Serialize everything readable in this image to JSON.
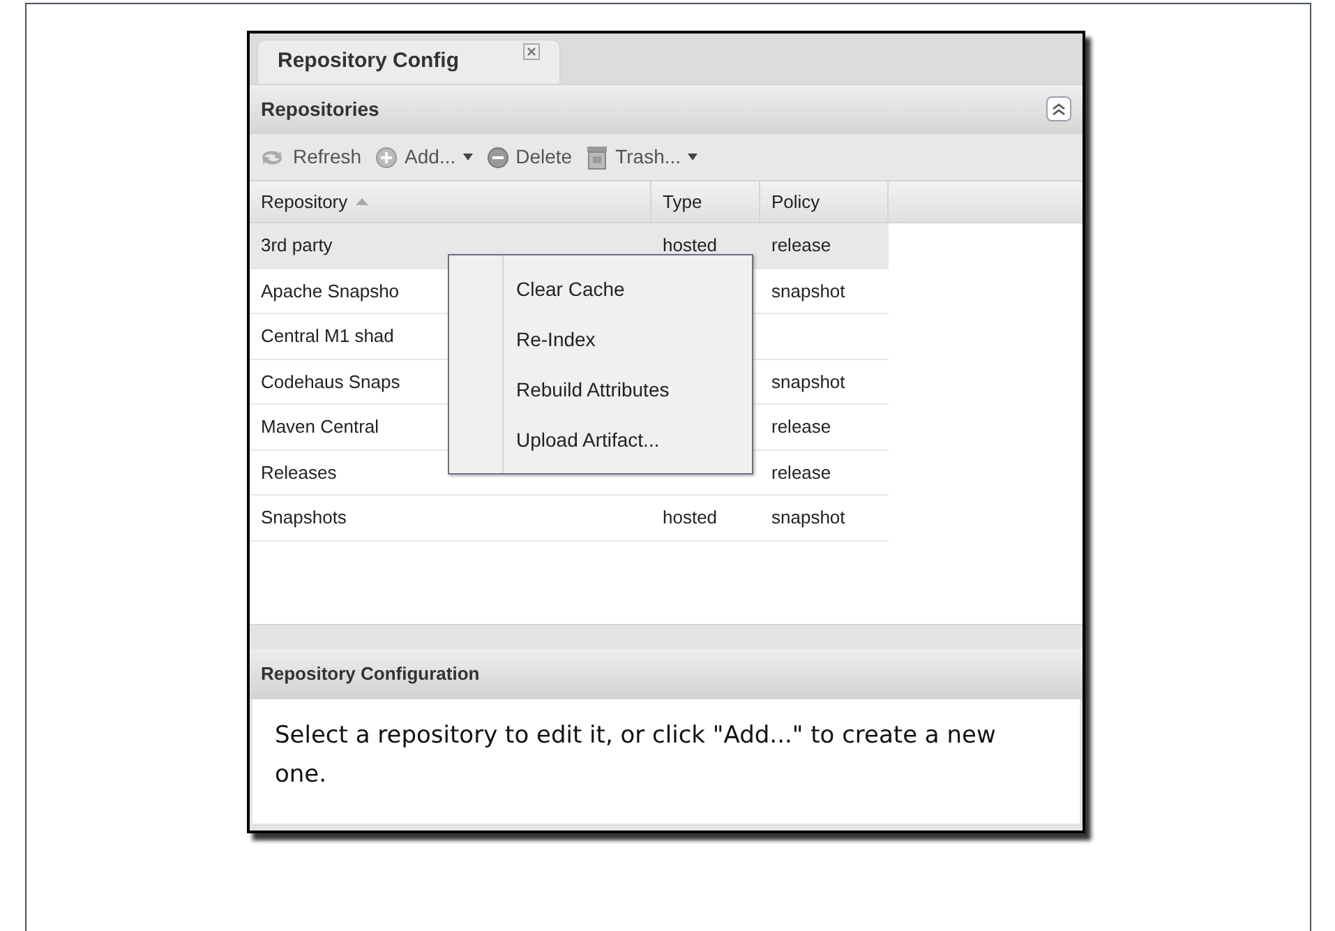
{
  "tabs": [
    {
      "label": "Repository Config",
      "selected": true
    }
  ],
  "repositories_panel": {
    "title": "Repositories"
  },
  "toolbar": [
    {
      "label": "Refresh",
      "dropdown": false
    },
    {
      "label": "Add...",
      "dropdown": true
    },
    {
      "label": "Delete",
      "dropdown": false
    },
    {
      "label": "Trash...",
      "dropdown": true
    }
  ],
  "table": {
    "columns": [
      {
        "label": "Repository",
        "sorted": true
      },
      {
        "label": "Type",
        "sorted": false
      },
      {
        "label": "Policy",
        "sorted": false
      }
    ],
    "rows": [
      {
        "repository": "3rd party",
        "type": "hosted",
        "policy": "release",
        "selected": true
      },
      {
        "repository": "Apache Snapsho",
        "policy": "snapshot",
        "selected": false
      },
      {
        "repository": "Central M1 shad",
        "selected": false
      },
      {
        "repository": "Codehaus Snaps",
        "policy": "snapshot",
        "selected": false
      },
      {
        "repository": "Maven Central",
        "policy": "release",
        "selected": false
      },
      {
        "repository": "Releases",
        "policy": "release",
        "selected": false
      },
      {
        "repository": "Snapshots",
        "type": "hosted",
        "policy": "snapshot",
        "selected": false
      }
    ]
  },
  "context_menu": [
    "Clear Cache",
    "Re-Index",
    "Rebuild Attributes",
    "Upload Artifact..."
  ],
  "configuration_panel": {
    "title": "Repository Configuration",
    "message": "Select a repository to edit it, or click \"Add...\" to create a new one."
  }
}
